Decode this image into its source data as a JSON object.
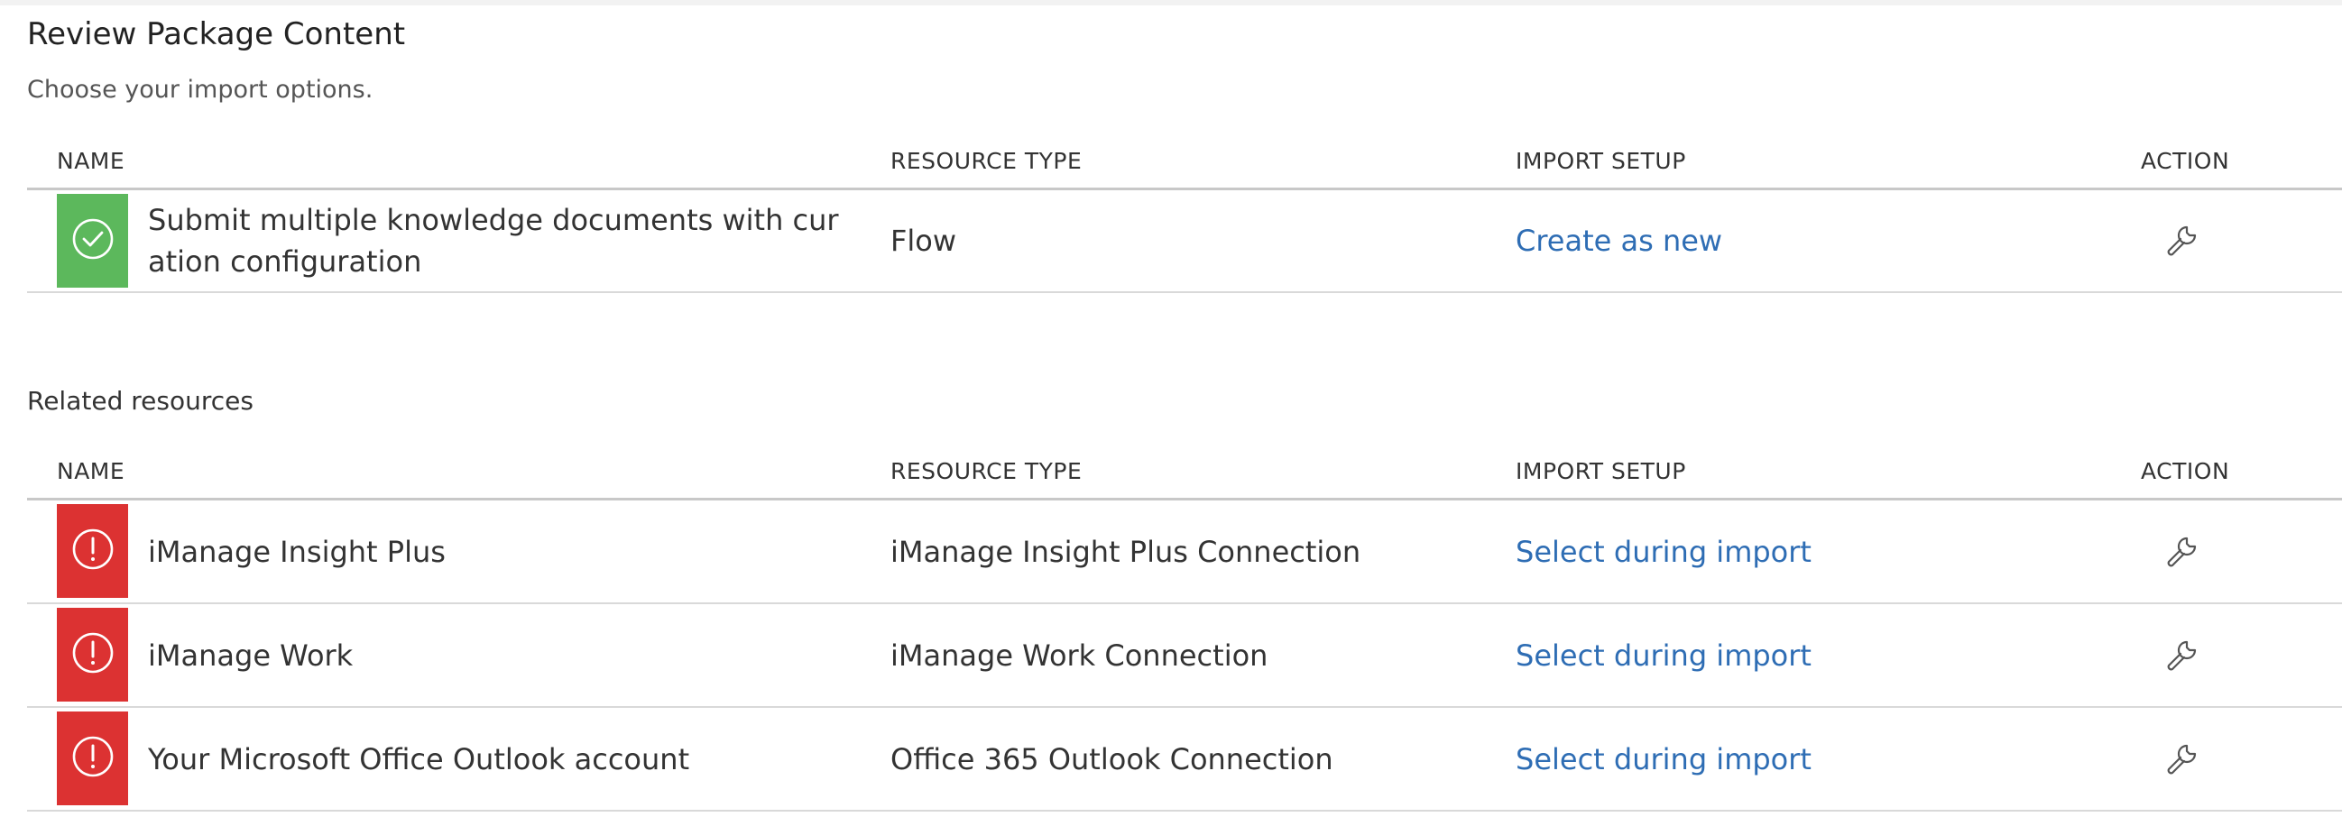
{
  "page": {
    "title": "Review Package Content",
    "subtitle": "Choose your import options."
  },
  "columns": {
    "name": "NAME",
    "resource_type": "RESOURCE TYPE",
    "import_setup": "IMPORT SETUP",
    "action": "ACTION"
  },
  "package_items": [
    {
      "status": "success",
      "status_icon": "check-circle-icon",
      "name": "Submit multiple knowledge documents with curation configuration",
      "resource_type": "Flow",
      "import_setup": "Create as new",
      "action_icon": "wrench-icon"
    }
  ],
  "related": {
    "title": "Related resources",
    "items": [
      {
        "status": "error",
        "status_icon": "exclamation-circle-icon",
        "name": "iManage Insight Plus",
        "resource_type": "iManage Insight Plus Connection",
        "import_setup": "Select during import",
        "action_icon": "wrench-icon"
      },
      {
        "status": "error",
        "status_icon": "exclamation-circle-icon",
        "name": "iManage Work",
        "resource_type": "iManage Work Connection",
        "import_setup": "Select during import",
        "action_icon": "wrench-icon"
      },
      {
        "status": "error",
        "status_icon": "exclamation-circle-icon",
        "name": "Your Microsoft Office Outlook account",
        "resource_type": "Office 365 Outlook Connection",
        "import_setup": "Select during import",
        "action_icon": "wrench-icon"
      }
    ]
  },
  "colors": {
    "success": "#5cb85c",
    "error": "#dc3232",
    "link": "#2e6db4",
    "divider": "#c8c8c8"
  }
}
